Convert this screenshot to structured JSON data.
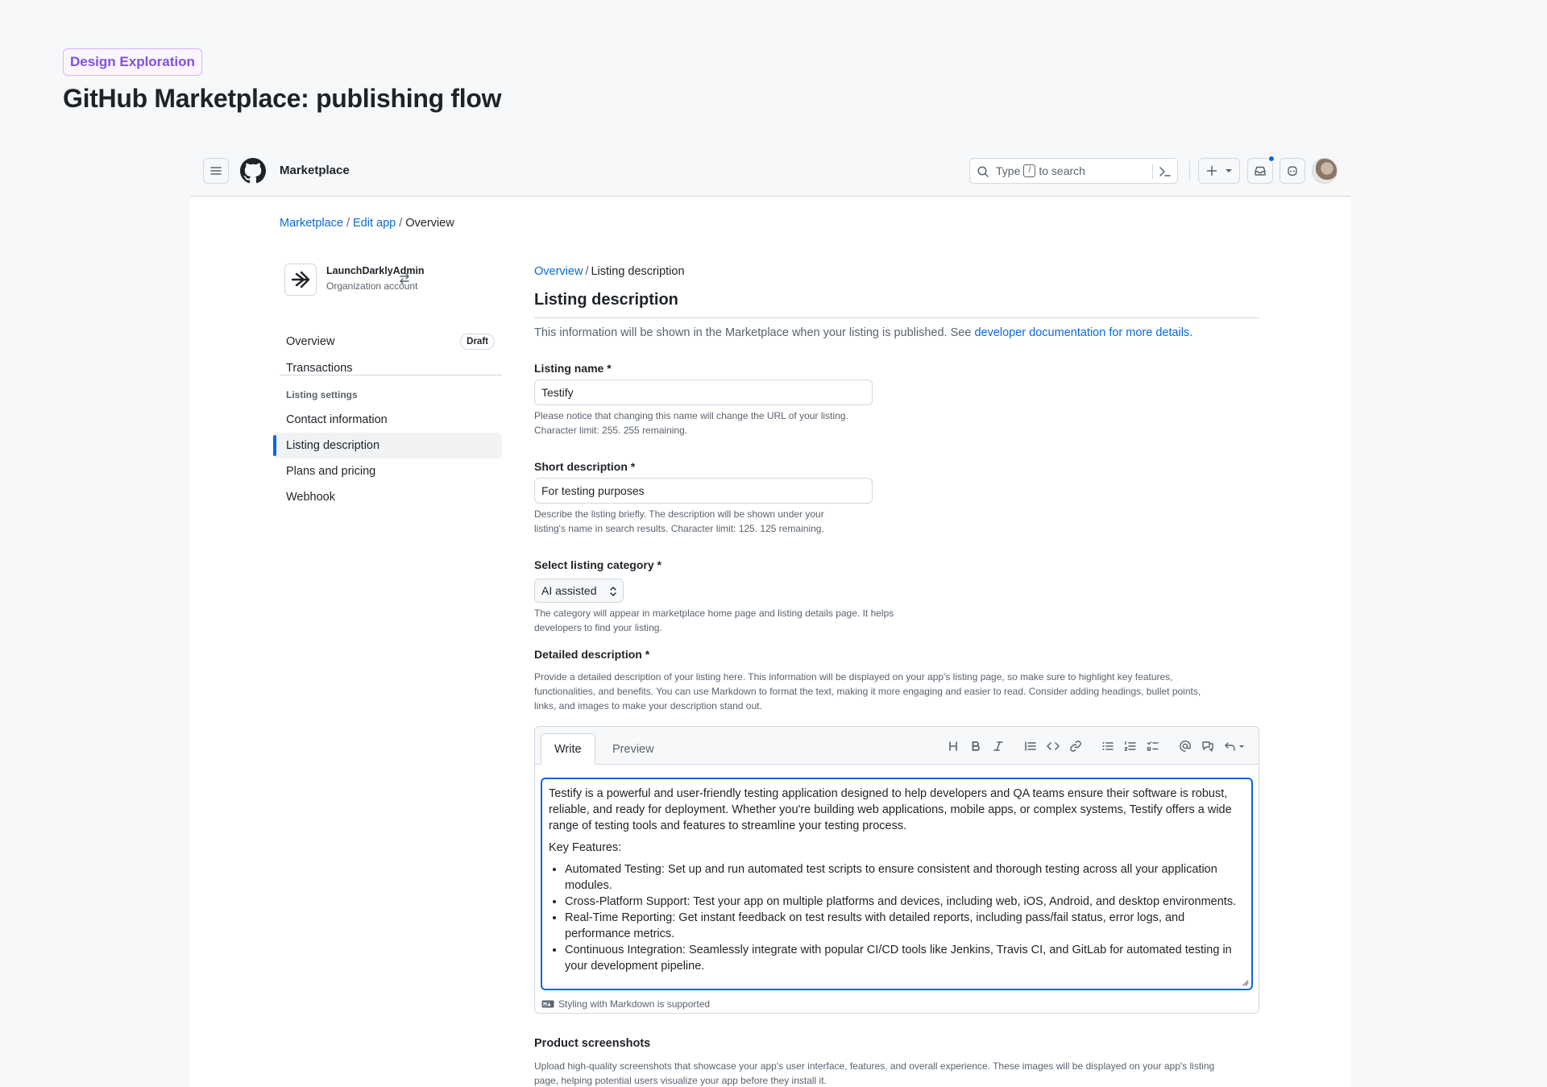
{
  "tag": "Design Exploration",
  "page_title": "GitHub Marketplace: publishing flow",
  "topbar": {
    "title": "Marketplace",
    "search_prefix": "Type",
    "search_key": "/",
    "search_suffix": "to search"
  },
  "breadcrumb": {
    "items": [
      "Marketplace",
      "Edit app",
      "Overview"
    ]
  },
  "sidebar": {
    "org_name": "LaunchDarklyAdmin",
    "org_type": "Organization account",
    "top_items": [
      {
        "label": "Overview",
        "badge": "Draft"
      },
      {
        "label": "Transactions"
      }
    ],
    "group_label": "Listing settings",
    "items": [
      {
        "label": "Contact information"
      },
      {
        "label": "Listing description"
      },
      {
        "label": "Plans and pricing"
      },
      {
        "label": "Webhook"
      }
    ],
    "active_item": "Listing description"
  },
  "main": {
    "crumb_parent": "Overview",
    "crumb_current": "Listing description",
    "title": "Listing description",
    "intro_text": "This information will be shown in the Marketplace when your listing is published. See",
    "intro_link": "developer documentation for more details.",
    "listing_name": {
      "label": "Listing name",
      "value": "Testify",
      "hint_1": "Please notice that changing this name will change the URL of your listing.",
      "hint_2": "Character limit: 255. 255 remaining."
    },
    "short_description": {
      "label": "Short description",
      "value": "For testing purposes",
      "hint_1": "Describe the listing briefly. The description will be shown under your",
      "hint_2": "listing's name in search results. Character limit: 125. 125 remaining."
    },
    "category": {
      "label": "Select listing category",
      "value": "AI assisted",
      "hint_1": "The category will appear in marketplace home page and listing details page. It helps",
      "hint_2": "developers to find your listing."
    },
    "detailed": {
      "label": "Detailed description",
      "hint_1": "Provide a detailed description of your listing here. This information will be displayed on your app's listing page, so make sure to highlight key features,",
      "hint_2": "functionalities, and benefits. You can use Markdown to format the text, making it more engaging and easier to read. Consider adding headings, bullet points,",
      "hint_3": "links, and images to make your description stand out.",
      "tab_write": "Write",
      "tab_preview": "Preview",
      "body_intro": "Testify is a powerful and user-friendly testing application designed to help developers and QA teams ensure their software is robust, reliable, and ready for deployment. Whether you're building web applications, mobile apps, or complex systems, Testify offers a wide range of testing tools and features to streamline your testing process.",
      "body_heading": "Key Features:",
      "bullets": [
        "Automated Testing: Set up and run automated test scripts to ensure consistent and thorough testing across all your application modules.",
        "Cross-Platform Support: Test your app on multiple platforms and devices, including web, iOS, Android, and desktop environments.",
        "Real-Time Reporting: Get instant feedback on test results with detailed reports, including pass/fail status, error logs, and performance metrics.",
        "Continuous Integration: Seamlessly integrate with popular CI/CD tools like Jenkins, Travis CI, and GitLab for automated testing in your development pipeline."
      ],
      "markdown_hint": "Styling with Markdown is supported"
    },
    "screenshots": {
      "label": "Product screenshots",
      "hint_1": "Upload high-quality screenshots that showcase your app's user interface, features, and overall experience. These images will be displayed on your app's listing",
      "hint_2": "page, helping potential users visualize your app before they install it."
    }
  },
  "colors": {
    "accent": "#0969da",
    "tag": "#8250df",
    "border": "#d1d9e0"
  }
}
